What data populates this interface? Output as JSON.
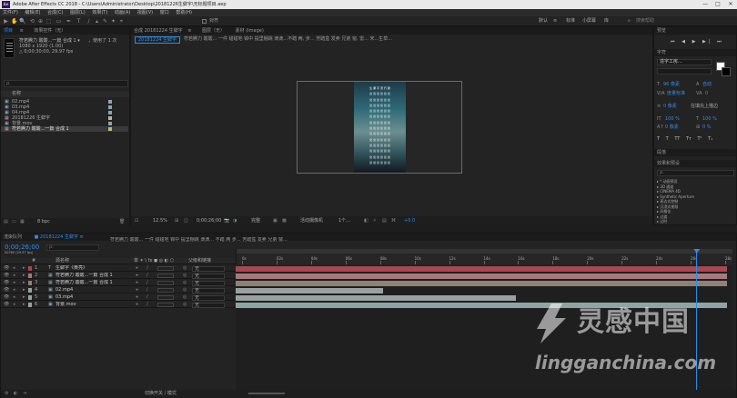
{
  "app": {
    "title": "Adobe After Effects CC 2018 - C:\\Users\\Administrator\\Desktop\\20181226生僻字\\无标题项目.aep",
    "window_controls": [
      "—",
      "□",
      "✕"
    ]
  },
  "menu": [
    "文件(F)",
    "编辑(E)",
    "合成(C)",
    "图层(L)",
    "效果(T)",
    "动画(A)",
    "视图(V)",
    "窗口",
    "帮助(H)"
  ],
  "toolbar": {
    "tools": [
      "▶",
      "✋",
      "🔍",
      "⟲",
      "⊕",
      "⬚",
      "▭",
      "✒",
      "T",
      "/",
      "▴",
      "✎",
      "✦",
      "⌖"
    ],
    "snap_label": "对齐",
    "workspaces": [
      "默认",
      "≡",
      "标准",
      "小屏幕",
      "库"
    ],
    "search_placeholder": "搜索帮助"
  },
  "project_panel": {
    "tabs": [
      "项目",
      "≡",
      "效果控件（无）"
    ],
    "preview_name": "符若腾力 酸酸...一篇 合成 1 ▾",
    "preview_used": "，使用了 1 次",
    "preview_dims": "1080 x 1920 (1.00)",
    "preview_dur": "△ 0;00;30;00, 29.97 fps",
    "search_placeholder": "ρ.",
    "col_name": "名称",
    "items": [
      {
        "name": "02.mp4",
        "icon": "▣"
      },
      {
        "name": "03.mp4",
        "icon": "▣"
      },
      {
        "name": "04.mp4",
        "icon": "▣"
      },
      {
        "name": "20181226 生僻字",
        "icon": "▦"
      },
      {
        "name": "背景.mov",
        "icon": "▣"
      },
      {
        "name": "符若腾力 酸酸...一篇 合成 1",
        "icon": "▦"
      }
    ],
    "footer": "8 bpc"
  },
  "comp_panel": {
    "tabs": [
      "合成 20181224 生僻字",
      "≡",
      "图层（无）",
      "素材 (Image)"
    ],
    "active_comp": "20181224 生僻字",
    "lyrics_bar": "符若腾力 酸酸... 一件 甜甜地 锦中 提里棚跳 滴滴...不踏 两, 步... 芳踏盒 发卖 兄弟 窗, 雷... 宋...生草...",
    "video_lyrics": [
      "生 僻 字 流 行 歌",
      "窗 窗 窗 窗 窗 窗",
      "窗 窗 窗 窗 窗 窗",
      "窗 窗 窗 窗 窗 窗",
      "窗 窗 窗 窗 窗 窗",
      "窗 窗 窗 窗 窗 窗",
      "窗 窗 窗 窗 窗 窗",
      "窗 窗 窗 窗 窗 窗",
      "窗 窗 窗 窗 窗 窗",
      "窗 窗 窗 窗 窗 窗",
      "窗 窗 窗 窗 窗 窗",
      "窗 窗 窗 窗 窗 窗",
      "窗 窗 窗 窗 窗 窗",
      "窗 窗 窗 窗 窗 窗"
    ],
    "footer": {
      "zoom": "12.5%",
      "timecode": "0;00;26;00",
      "quality": "完整",
      "camera": "活动摄像机",
      "views": "1个...",
      "offset": "+0.0"
    }
  },
  "right_panel": {
    "preview_tab": "预览",
    "preview_controls": [
      "⏮",
      "◀",
      "▶",
      "▶|",
      "⏭"
    ],
    "char_tab": "字符",
    "font_name": "造字工房...",
    "font_style": "",
    "font_size": "96 像素",
    "leading": "自动",
    "tracking": "0",
    "kerning": "度量标准",
    "stroke": "在填充上描边",
    "stroke_width": "0 像素",
    "vscale": "100 %",
    "hscale": "100 %",
    "baseline": "0 像素",
    "tsume": "0 %",
    "styles": [
      "T",
      "T",
      "TT",
      "Tт",
      "T¹",
      "T₁"
    ],
    "para_tab": "段落",
    "effects_tab": "效果和预设",
    "effects_search": "ρ.",
    "effects_tree": [
      "▸ * 动画预设",
      "▸ 3D 通道",
      "▸ CINEMA 4D",
      "▸ Synthetic Aperture",
      "▸ 表达式控制",
      "▸ 沉浸式视频",
      "▸ 风格化",
      "▸ 过渡",
      "▸ 过时"
    ]
  },
  "timeline": {
    "tabs": [
      "渲染队列",
      "■ 20181224 生僻字 ≡"
    ],
    "timecode": "0;00;26;00",
    "timecode_sub": "00780 (29.97 fps)",
    "search_placeholder": "ρ.",
    "lyrics_bar": "符若腾力 酸酸... 一件 甜甜地 锦中 提里棚跳 滴滴... 不踏 两 步... 芳踏盒 发卖 兄弟 窗...",
    "col_num": "#",
    "col_name": "源名称",
    "col_switch": "单 ✶ \\ fx ◼ ◎ ◐ ⬡",
    "col_parent": "父级和链接",
    "ruler": [
      "0s",
      "02s",
      "04s",
      "06s",
      "08s",
      "10s",
      "12s",
      "14s",
      "16s",
      "18s",
      "20s",
      "22s",
      "24s",
      "26s",
      "28s"
    ],
    "layers": [
      {
        "num": "1",
        "icon": "T",
        "name": "生僻字《黄亮》",
        "parent": "无",
        "color": "#a94650",
        "bar_end": 1.0
      },
      {
        "num": "2",
        "icon": "▦",
        "name": "符若腾力 酸酸...一篇 合成 1",
        "parent": "无",
        "color": "#a47a7c",
        "bar_end": 1.0
      },
      {
        "num": "3",
        "icon": "▦",
        "name": "符若腾力 酸酸...一篇 合成 1",
        "parent": "无",
        "color": "#8c8278",
        "bar_end": 1.0
      },
      {
        "num": "4",
        "icon": "▣",
        "name": "02.mp4",
        "parent": "无",
        "color": "#9aa1a1",
        "bar_end": 0.3
      },
      {
        "num": "5",
        "icon": "▣",
        "name": "03.mp4",
        "parent": "无",
        "color": "#9aa1a1",
        "bar_end": 0.57
      },
      {
        "num": "6",
        "icon": "▣",
        "name": "背景.mov",
        "parent": "无",
        "color": "#8fa5a5",
        "bar_end": 1.0
      }
    ],
    "playhead": 0.929,
    "footer": "切换开关 / 模式"
  },
  "watermark": {
    "brand": "灵感中国",
    "url": "lingganchina.com"
  }
}
